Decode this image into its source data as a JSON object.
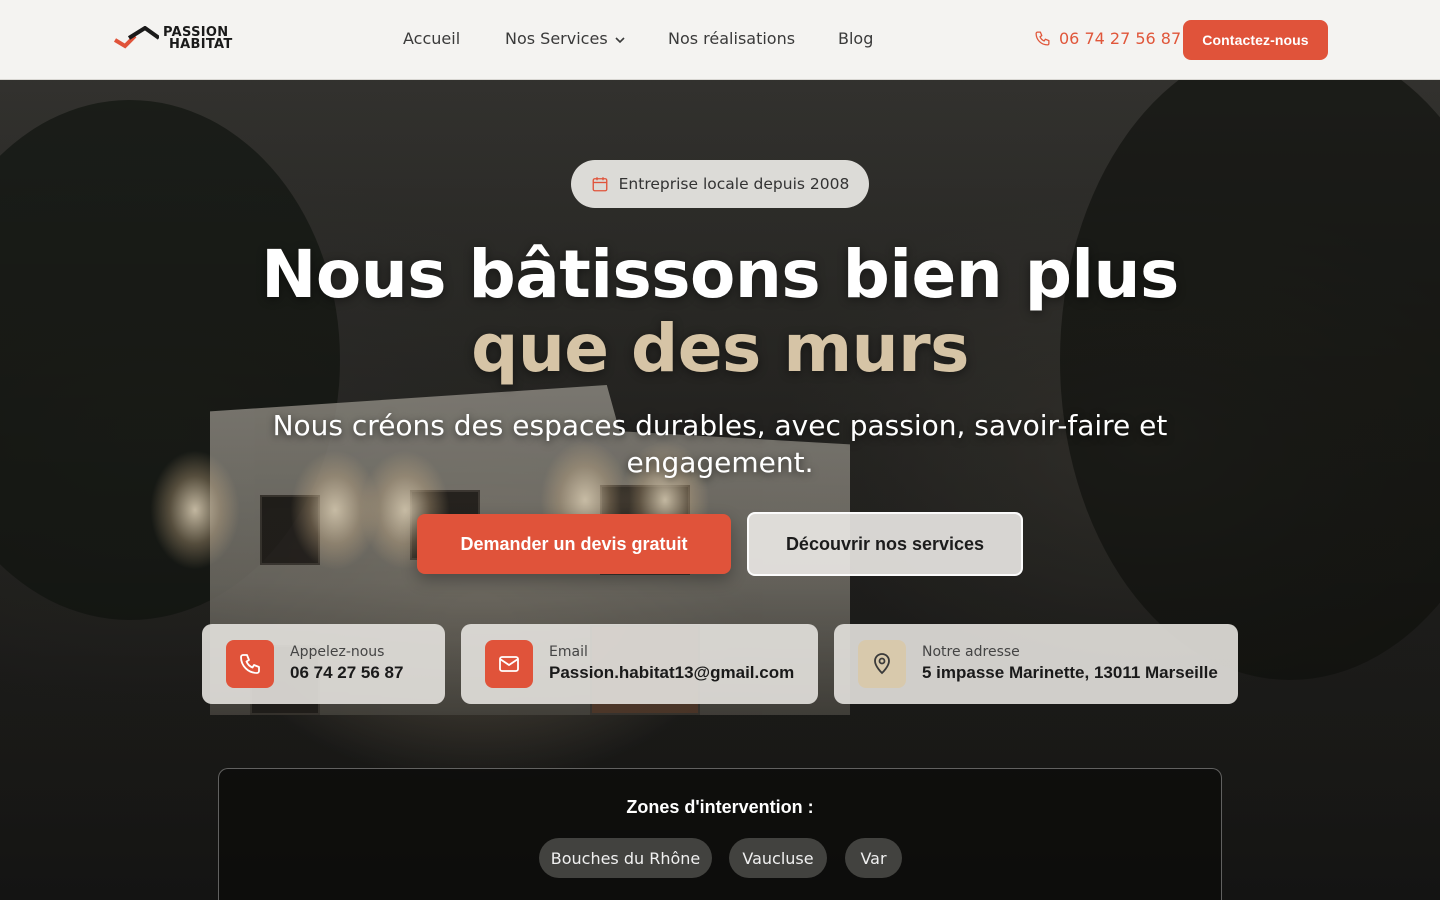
{
  "header": {
    "logo": {
      "line1": "PASSION",
      "line2": "HABITAT"
    },
    "nav": [
      {
        "label": "Accueil"
      },
      {
        "label": "Nos Services"
      },
      {
        "label": "Nos réalisations"
      },
      {
        "label": "Blog"
      }
    ],
    "phone": "06 74 27 56 87",
    "contact_button": "Contactez-nous"
  },
  "hero": {
    "badge": "Entreprise locale depuis 2008",
    "title_line1": "Nous bâtissons bien plus",
    "title_line2": "que des murs",
    "subtitle": "Nous créons des espaces durables, avec passion, savoir-faire et engagement.",
    "primary_button": "Demander un devis gratuit",
    "secondary_button": "Découvrir nos services"
  },
  "contact_cards": [
    {
      "label": "Appelez-nous",
      "value": "06 74 27 56 87",
      "icon": "phone-icon"
    },
    {
      "label": "Email",
      "value": "Passion.habitat13@gmail.com",
      "icon": "mail-icon"
    },
    {
      "label": "Notre adresse",
      "value": "5 impasse Marinette, 13011 Marseille",
      "icon": "map-pin-icon"
    }
  ],
  "zones": {
    "title": "Zones d'intervention :",
    "items": [
      "Bouches du Rhône",
      "Vaucluse",
      "Var"
    ]
  },
  "colors": {
    "accent": "#e0533a",
    "beige": "#d6c4a6",
    "header_bg": "#f4f3f1"
  }
}
